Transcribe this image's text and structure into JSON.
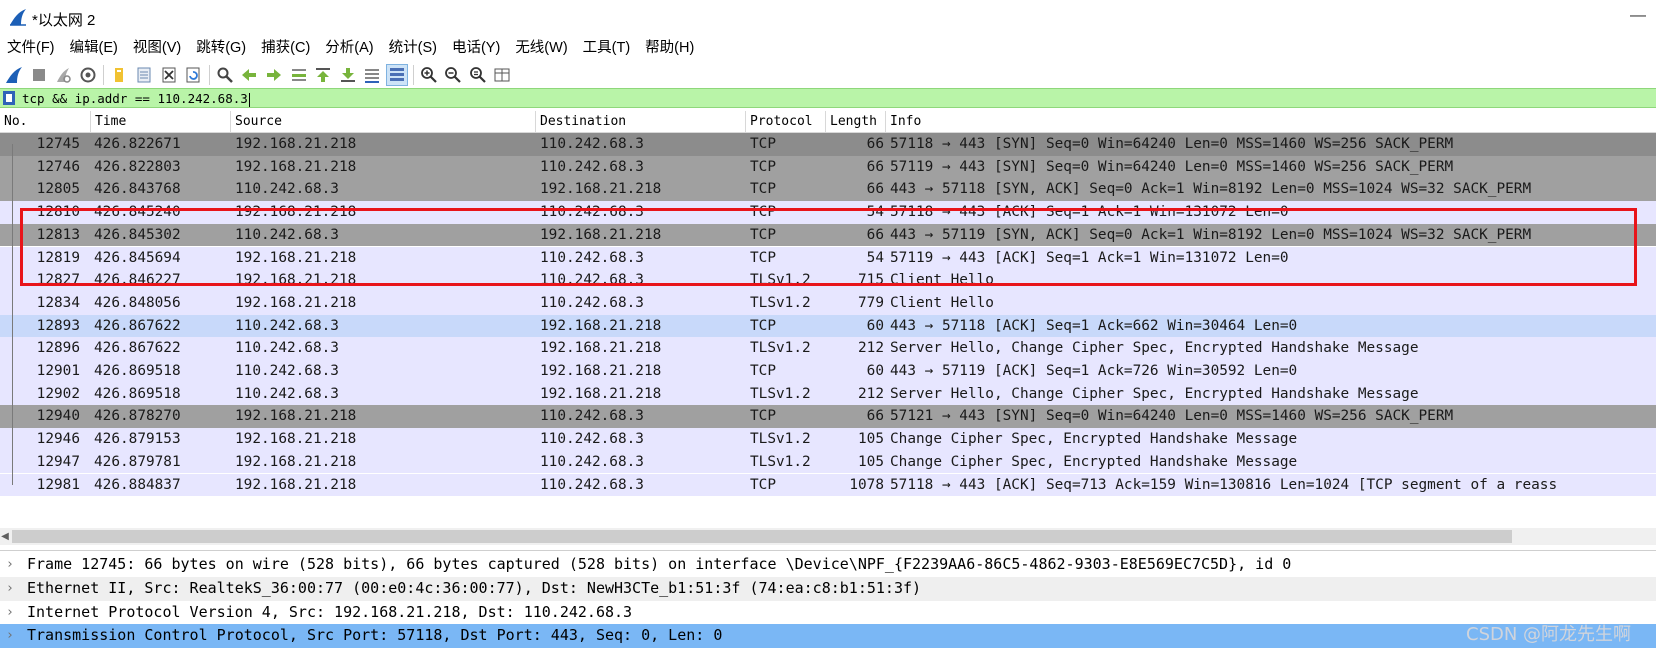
{
  "window": {
    "title": "*以太网 2",
    "minimize_glyph": "—"
  },
  "menu": [
    "文件(F)",
    "编辑(E)",
    "视图(V)",
    "跳转(G)",
    "捕获(C)",
    "分析(A)",
    "统计(S)",
    "电话(Y)",
    "无线(W)",
    "工具(T)",
    "帮助(H)"
  ],
  "toolbar": {
    "icons": [
      "shark-fin-start-icon",
      "stop-icon",
      "restart-icon",
      "options-gear-icon",
      "open-folder-icon",
      "save-file-icon",
      "close-file-icon",
      "reload-icon",
      "find-icon",
      "back-arrow-icon",
      "forward-arrow-icon",
      "goto-packet-icon",
      "first-packet-icon",
      "last-packet-icon",
      "autoscroll-icon",
      "colorize-icon",
      "zoom-in-icon",
      "zoom-out-icon",
      "zoom-normal-icon",
      "resize-columns-icon"
    ]
  },
  "filter": {
    "value": "tcp && ip.addr == 110.242.68.3"
  },
  "packet_list": {
    "columns": [
      "No.",
      "Time",
      "Source",
      "Destination",
      "Protocol",
      "Length",
      "Info"
    ],
    "rows": [
      {
        "no": "12745",
        "time": "426.822671",
        "src": "192.168.21.218",
        "dst": "110.242.68.3",
        "proto": "TCP",
        "len": "66",
        "info": "57118 → 443 [SYN] Seq=0 Win=64240 Len=0 MSS=1460 WS=256 SACK_PERM",
        "style": "syn first"
      },
      {
        "no": "12746",
        "time": "426.822803",
        "src": "192.168.21.218",
        "dst": "110.242.68.3",
        "proto": "TCP",
        "len": "66",
        "info": "57119 → 443 [SYN] Seq=0 Win=64240 Len=0 MSS=1460 WS=256 SACK_PERM",
        "style": "syn"
      },
      {
        "no": "12805",
        "time": "426.843768",
        "src": "110.242.68.3",
        "dst": "192.168.21.218",
        "proto": "TCP",
        "len": "66",
        "info": "443 → 57118 [SYN, ACK] Seq=0 Ack=1 Win=8192 Len=0 MSS=1024 WS=32 SACK_PERM",
        "style": "syn"
      },
      {
        "no": "12810",
        "time": "426.845240",
        "src": "192.168.21.218",
        "dst": "110.242.68.3",
        "proto": "TCP",
        "len": "54",
        "info": "57118 → 443 [ACK] Seq=1 Ack=1 Win=131072 Len=0",
        "style": "tcp"
      },
      {
        "no": "12813",
        "time": "426.845302",
        "src": "110.242.68.3",
        "dst": "192.168.21.218",
        "proto": "TCP",
        "len": "66",
        "info": "443 → 57119 [SYN, ACK] Seq=0 Ack=1 Win=8192 Len=0 MSS=1024 WS=32 SACK_PERM",
        "style": "syn"
      },
      {
        "no": "12819",
        "time": "426.845694",
        "src": "192.168.21.218",
        "dst": "110.242.68.3",
        "proto": "TCP",
        "len": "54",
        "info": "57119 → 443 [ACK] Seq=1 Ack=1 Win=131072 Len=0",
        "style": "tcp"
      },
      {
        "no": "12827",
        "time": "426.846227",
        "src": "192.168.21.218",
        "dst": "110.242.68.3",
        "proto": "TLSv1.2",
        "len": "715",
        "info": "Client Hello",
        "style": "tls"
      },
      {
        "no": "12834",
        "time": "426.848056",
        "src": "192.168.21.218",
        "dst": "110.242.68.3",
        "proto": "TLSv1.2",
        "len": "779",
        "info": "Client Hello",
        "style": "tls"
      },
      {
        "no": "12893",
        "time": "426.867622",
        "src": "110.242.68.3",
        "dst": "192.168.21.218",
        "proto": "TCP",
        "len": "60",
        "info": "443 → 57118 [ACK] Seq=1 Ack=662 Win=30464 Len=0",
        "style": "sel"
      },
      {
        "no": "12896",
        "time": "426.867622",
        "src": "110.242.68.3",
        "dst": "192.168.21.218",
        "proto": "TLSv1.2",
        "len": "212",
        "info": "Server Hello, Change Cipher Spec, Encrypted Handshake Message",
        "style": "tls"
      },
      {
        "no": "12901",
        "time": "426.869518",
        "src": "110.242.68.3",
        "dst": "192.168.21.218",
        "proto": "TCP",
        "len": "60",
        "info": "443 → 57119 [ACK] Seq=1 Ack=726 Win=30592 Len=0",
        "style": "tcp"
      },
      {
        "no": "12902",
        "time": "426.869518",
        "src": "110.242.68.3",
        "dst": "192.168.21.218",
        "proto": "TLSv1.2",
        "len": "212",
        "info": "Server Hello, Change Cipher Spec, Encrypted Handshake Message",
        "style": "tls"
      },
      {
        "no": "12940",
        "time": "426.878270",
        "src": "192.168.21.218",
        "dst": "110.242.68.3",
        "proto": "TCP",
        "len": "66",
        "info": "57121 → 443 [SYN] Seq=0 Win=64240 Len=0 MSS=1460 WS=256 SACK_PERM",
        "style": "syn"
      },
      {
        "no": "12946",
        "time": "426.879153",
        "src": "192.168.21.218",
        "dst": "110.242.68.3",
        "proto": "TLSv1.2",
        "len": "105",
        "info": "Change Cipher Spec, Encrypted Handshake Message",
        "style": "tls"
      },
      {
        "no": "12947",
        "time": "426.879781",
        "src": "192.168.21.218",
        "dst": "110.242.68.3",
        "proto": "TLSv1.2",
        "len": "105",
        "info": "Change Cipher Spec, Encrypted Handshake Message",
        "style": "tls"
      },
      {
        "no": "12981",
        "time": "426.884837",
        "src": "192.168.21.218",
        "dst": "110.242.68.3",
        "proto": "TCP",
        "len": "1078",
        "info": "57118 → 443 [ACK] Seq=713 Ack=159 Win=130816 Len=1024 [TCP segment of a reass",
        "style": "tcp"
      }
    ]
  },
  "details": [
    {
      "text": "Frame 12745: 66 bytes on wire (528 bits), 66 bytes captured (528 bits) on interface \\Device\\NPF_{F2239AA6-86C5-4862-9303-E8E569EC7C5D}, id 0",
      "style": ""
    },
    {
      "text": "Ethernet II, Src: RealtekS_36:00:77 (00:e0:4c:36:00:77), Dst: NewH3CTe_b1:51:3f (74:ea:c8:b1:51:3f)",
      "style": "alt"
    },
    {
      "text": "Internet Protocol Version 4, Src: 192.168.21.218, Dst: 110.242.68.3",
      "style": ""
    },
    {
      "text": "Transmission Control Protocol, Src Port: 57118, Dst Port: 443, Seq: 0, Len: 0",
      "style": "sel"
    }
  ],
  "details_arrow": "›",
  "watermark": "CSDN @阿龙先生啊",
  "colors": {
    "filter_bg": "#b9f4a8",
    "syn_row": "#a0a0a0",
    "tcp_row": "#e7e6ff",
    "selected_row": "#c8d9fa",
    "highlight_box": "#e8141a",
    "detail_selected": "#7ab7f5"
  }
}
